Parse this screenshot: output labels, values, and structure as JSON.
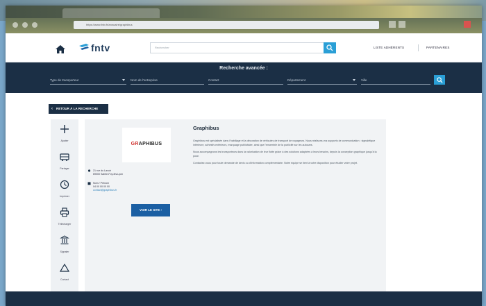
{
  "browser": {
    "url": "https://www.fntv.fr/annuaire/graphibus"
  },
  "header": {
    "logo_text": "fntv",
    "search_placeholder": "Rechercher",
    "links": [
      "LISTE ADHÉRENTS",
      "PARTENAIRES"
    ]
  },
  "advanced_search": {
    "title": "Recherche avancée :",
    "fields": [
      {
        "label": "Type de transporteur",
        "dropdown": true
      },
      {
        "label": "Nom de l'entreprise",
        "dropdown": false
      },
      {
        "label": "Contact",
        "dropdown": false
      },
      {
        "label": "Département",
        "dropdown": true
      },
      {
        "label": "Ville",
        "dropdown": false
      }
    ]
  },
  "back_button": "RETOUR À LA RECHERCHE",
  "tools": [
    {
      "label": "Ajouter",
      "icon": "plus-icon"
    },
    {
      "label": "Partager",
      "icon": "bus-icon"
    },
    {
      "label": "Imprimer",
      "icon": "clock-icon"
    },
    {
      "label": "Télécharger",
      "icon": "print-icon"
    },
    {
      "label": "Signaler",
      "icon": "building-icon"
    },
    {
      "label": "Contact",
      "icon": "triangle-icon"
    }
  ],
  "company": {
    "logo_brand_prefix": "GR",
    "logo_brand_rest": "APHIBUS",
    "name": "Graphibus",
    "address_line1": "21 rue du Lavoir",
    "address_line2": "69000 Sainte-Foy-lès-Lyon",
    "phone": "Nom / Prénom",
    "phone_line2": "04 00 00 00 00",
    "email": "contact@graphibus.fr",
    "visit_button": "VOIR LE SITE",
    "descriptions": [
      "Graphibus est spécialisée dans l'habillage et la décoration de véhicules de transport de voyageurs. Nous réalisons vos supports de communication : signalétique intérieure, adhésifs extérieurs, marquage publicitaire, ainsi que l'ensemble de la publicité sur les autocars.",
      "Nous accompagnons les transporteurs dans la valorisation de leur flotte grâce à des solutions adaptées à leurs besoins, depuis la conception graphique jusqu'à la pose.",
      "Contactez-nous pour toute demande de devis ou d'information complémentaire. Notre équipe se tient à votre disposition pour étudier votre projet."
    ]
  }
}
